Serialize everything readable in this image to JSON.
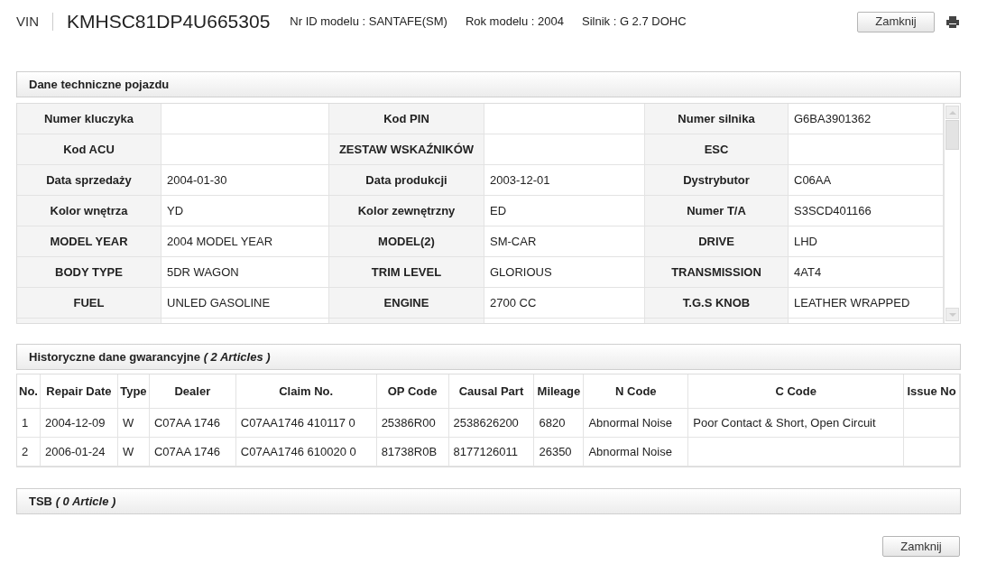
{
  "header": {
    "vin_label": "VIN",
    "vin": "KMHSC81DP4U665305",
    "info": [
      "Nr ID modelu : SANTAFE(SM)",
      "Rok modelu : 2004",
      "Silnik : G 2.7 DOHC"
    ],
    "close_button": "Zamknij"
  },
  "specs": {
    "title": "Dane techniczne pojazdu",
    "rows": [
      [
        {
          "label": "Numer kluczyka"
        },
        {
          "label": "Kod PIN"
        },
        {
          "label": "Numer silnika",
          "value": "G6BA3901362"
        }
      ],
      [
        {
          "label": "Kod ACU"
        },
        {
          "label": "ZESTAW WSKAŹNIKÓW"
        },
        {
          "label": "ESC"
        }
      ],
      [
        {
          "label": "Data sprzedaży",
          "value": "2004-01-30"
        },
        {
          "label": "Data produkcji",
          "value": "2003-12-01"
        },
        {
          "label": "Dystrybutor",
          "value": "C06AA"
        }
      ],
      [
        {
          "label": "Kolor wnętrza",
          "value": "YD"
        },
        {
          "label": "Kolor zewnętrzny",
          "value": "ED"
        },
        {
          "label": "Numer T/A",
          "value": "S3SCD401166"
        }
      ],
      [
        {
          "label": "MODEL YEAR",
          "value": "2004 MODEL YEAR"
        },
        {
          "label": "MODEL(2)",
          "value": "SM-CAR"
        },
        {
          "label": "DRIVE",
          "value": "LHD"
        }
      ],
      [
        {
          "label": "BODY TYPE",
          "value": "5DR WAGON"
        },
        {
          "label": "TRIM LEVEL",
          "value": "GLORIOUS"
        },
        {
          "label": "TRANSMISSION",
          "value": "4AT4"
        }
      ],
      [
        {
          "label": "FUEL",
          "value": "UNLED GASOLINE"
        },
        {
          "label": "ENGINE",
          "value": "2700 CC"
        },
        {
          "label": "T.G.S KNOB",
          "value": "LEATHER WRAPPED"
        }
      ]
    ]
  },
  "warranty": {
    "title": "Historyczne dane gwarancyjne *( 2 Articles )*",
    "columns": [
      "No.",
      "Repair Date",
      "Type",
      "Dealer",
      "Claim No.",
      "OP Code",
      "Causal Part",
      "Mileage",
      "N Code",
      "C Code",
      "Issue No"
    ],
    "rows": [
      [
        "1",
        "2004-12-09",
        "W",
        "C07AA 1746",
        "C07AA1746 410117 0",
        "25386R00",
        "2538626200",
        "6820",
        "Abnormal Noise",
        "Poor Contact & Short, Open Circuit",
        null
      ],
      [
        "2",
        "2006-01-24",
        "W",
        "C07AA 1746",
        "C07AA1746 610020 0",
        "81738R0B",
        "8177126011",
        "26350",
        "Abnormal Noise",
        null,
        null
      ]
    ]
  },
  "tsb": {
    "title": "TSB *( 0 Article )*"
  },
  "footer": {
    "close_button": "Zamknij"
  }
}
